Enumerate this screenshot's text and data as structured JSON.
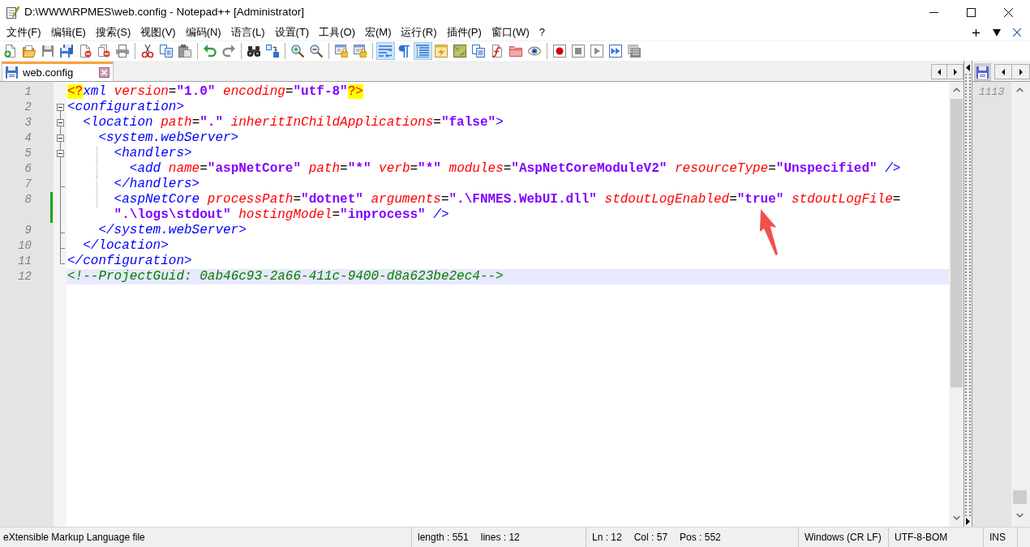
{
  "window": {
    "title": "D:\\WWW\\RPMES\\web.config - Notepad++ [Administrator]"
  },
  "menu": [
    "文件(F)",
    "编辑(E)",
    "搜索(S)",
    "视图(V)",
    "编码(N)",
    "语言(L)",
    "设置(T)",
    "工具(O)",
    "宏(M)",
    "运行(R)",
    "插件(P)",
    "窗口(W)",
    "?"
  ],
  "toolbar": {
    "word_wrap_pressed": true,
    "indent_guide_pressed": true
  },
  "tabs": [
    {
      "label": "web.config",
      "selected": true
    }
  ],
  "editor": {
    "lines": [
      {
        "number": "1",
        "changed": false,
        "current": false,
        "segments": [
          {
            "tokens": [
              {
                "kind": "pi",
                "text": "<?"
              },
              {
                "kind": "tag",
                "text": "xml"
              },
              {
                "kind": "attr",
                "text": " version"
              },
              {
                "kind": "eq",
                "text": "="
              },
              {
                "kind": "value",
                "text": "\"1.0\""
              },
              {
                "kind": "attr",
                "text": " encoding"
              },
              {
                "kind": "eq",
                "text": "="
              },
              {
                "kind": "value",
                "text": "\"utf-8\""
              },
              {
                "kind": "pi",
                "text": "?>"
              }
            ]
          }
        ]
      },
      {
        "number": "2",
        "changed": false,
        "current": false,
        "fold": {
          "kind": "header",
          "expanded": true
        },
        "segments": [
          {
            "tokens": [
              {
                "kind": "tag",
                "text": "<configuration>"
              }
            ]
          }
        ]
      },
      {
        "number": "3",
        "changed": false,
        "current": false,
        "fold": {
          "kind": "header",
          "expanded": true
        },
        "segments": [
          {
            "tokens": [
              {
                "kind": "tag",
                "text": "  <location"
              },
              {
                "kind": "attr",
                "text": " path"
              },
              {
                "kind": "eq",
                "text": "="
              },
              {
                "kind": "value",
                "text": "\".\""
              },
              {
                "kind": "attr",
                "text": " inheritInChildApplications"
              },
              {
                "kind": "eq",
                "text": "="
              },
              {
                "kind": "value",
                "text": "\"false\""
              },
              {
                "kind": "tag",
                "text": ">"
              }
            ]
          }
        ]
      },
      {
        "number": "4",
        "changed": false,
        "current": false,
        "fold": {
          "kind": "header",
          "expanded": true
        },
        "segments": [
          {
            "tokens": [
              {
                "kind": "tag",
                "text": "    <system.webServer>"
              }
            ]
          }
        ]
      },
      {
        "number": "5",
        "changed": false,
        "current": false,
        "fold": {
          "kind": "header",
          "expanded": true
        },
        "segments": [
          {
            "tokens": [
              {
                "kind": "tag",
                "text": "      <handlers>"
              }
            ]
          }
        ]
      },
      {
        "number": "6",
        "changed": false,
        "current": false,
        "fold": {
          "kind": "body"
        },
        "segments": [
          {
            "tokens": [
              {
                "kind": "tag",
                "text": "        <add"
              },
              {
                "kind": "attr",
                "text": " name"
              },
              {
                "kind": "eq",
                "text": "="
              },
              {
                "kind": "value",
                "text": "\"aspNetCore\""
              },
              {
                "kind": "attr",
                "text": " path"
              },
              {
                "kind": "eq",
                "text": "="
              },
              {
                "kind": "value",
                "text": "\"*\""
              },
              {
                "kind": "attr",
                "text": " verb"
              },
              {
                "kind": "eq",
                "text": "="
              },
              {
                "kind": "value",
                "text": "\"*\""
              },
              {
                "kind": "attr",
                "text": " modules"
              },
              {
                "kind": "eq",
                "text": "="
              },
              {
                "kind": "value",
                "text": "\"AspNetCoreModuleV2\""
              },
              {
                "kind": "attr",
                "text": " resourceType"
              },
              {
                "kind": "eq",
                "text": "="
              },
              {
                "kind": "value",
                "text": "\"Unspecified\""
              },
              {
                "kind": "tag",
                "text": " />"
              }
            ]
          }
        ]
      },
      {
        "number": "7",
        "changed": false,
        "current": false,
        "fold": {
          "kind": "tail"
        },
        "segments": [
          {
            "tokens": [
              {
                "kind": "tag",
                "text": "      </handlers>"
              }
            ]
          }
        ]
      },
      {
        "number": "8",
        "changed": true,
        "current": false,
        "fold": {
          "kind": "body"
        },
        "segments": [
          {
            "tokens": [
              {
                "kind": "tag",
                "text": "      <aspNetCore"
              },
              {
                "kind": "attr",
                "text": " processPath"
              },
              {
                "kind": "eq",
                "text": "="
              },
              {
                "kind": "value",
                "text": "\"dotnet\""
              },
              {
                "kind": "attr",
                "text": " arguments"
              },
              {
                "kind": "eq",
                "text": "="
              },
              {
                "kind": "value",
                "text": "\".\\FNMES.WebUI.dll\""
              },
              {
                "kind": "attr",
                "text": " stdoutLogEnabled"
              },
              {
                "kind": "eq",
                "text": "="
              },
              {
                "kind": "value",
                "text": "\"true\""
              },
              {
                "kind": "attr",
                "text": " stdoutLogFile"
              },
              {
                "kind": "eq",
                "text": "="
              }
            ]
          },
          {
            "tokens": [
              {
                "kind": "value",
                "text": "\".\\logs\\stdout\""
              },
              {
                "kind": "attr",
                "text": " hostingModel"
              },
              {
                "kind": "eq",
                "text": "="
              },
              {
                "kind": "value",
                "text": "\"inprocess\""
              },
              {
                "kind": "tag",
                "text": " />"
              }
            ]
          }
        ]
      },
      {
        "number": "9",
        "changed": false,
        "current": false,
        "fold": {
          "kind": "tail"
        },
        "segments": [
          {
            "tokens": [
              {
                "kind": "tag",
                "text": "    </system.webServer>"
              }
            ]
          }
        ]
      },
      {
        "number": "10",
        "changed": false,
        "current": false,
        "fold": {
          "kind": "tail"
        },
        "segments": [
          {
            "tokens": [
              {
                "kind": "tag",
                "text": "  </location>"
              }
            ]
          }
        ]
      },
      {
        "number": "11",
        "changed": false,
        "current": false,
        "fold": {
          "kind": "end"
        },
        "segments": [
          {
            "tokens": [
              {
                "kind": "tag",
                "text": "</configuration>"
              }
            ]
          }
        ]
      },
      {
        "number": "12",
        "changed": false,
        "current": true,
        "segments": [
          {
            "tokens": [
              {
                "kind": "comment",
                "text": "<!--ProjectGuid: 0ab46c93-2a66-411c-9400-d8a623be2ec4-->"
              }
            ]
          }
        ]
      }
    ]
  },
  "side_view": {
    "line_number": "1113"
  },
  "status_bar": [
    {
      "items": [
        "eXtensible Markup Language file"
      ]
    },
    {
      "items": [
        "length : 551",
        "lines : 12"
      ]
    },
    {
      "items": [
        "Ln : 12",
        "Col : 57",
        "Pos : 552"
      ]
    },
    {
      "items": [
        "Windows (CR LF)"
      ]
    },
    {
      "items": [
        "UTF-8-BOM"
      ]
    },
    {
      "items": [
        "INS"
      ]
    }
  ]
}
